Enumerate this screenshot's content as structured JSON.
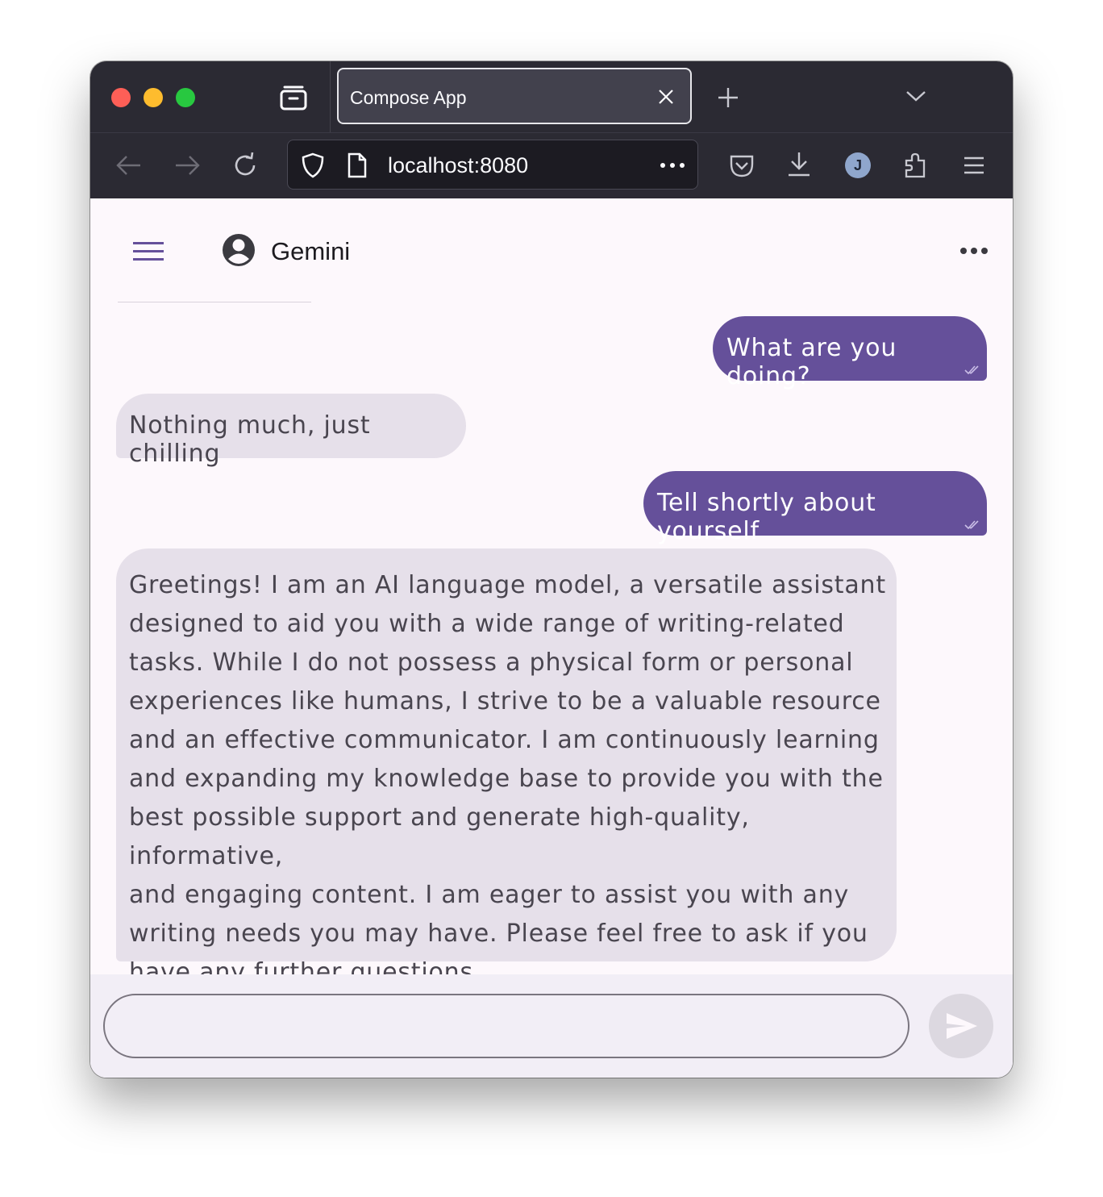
{
  "browser": {
    "tab_title": "Compose App",
    "url": "localhost:8080",
    "profile_initial": "J"
  },
  "app": {
    "title": "Gemini"
  },
  "messages": [
    {
      "role": "user",
      "text": "What are you doing?",
      "status": "read"
    },
    {
      "role": "bot",
      "text": "Nothing much, just chilling"
    },
    {
      "role": "user",
      "text": "Tell shortly about yourself",
      "status": "read"
    },
    {
      "role": "bot",
      "lines": [
        "Greetings! I am an AI language model, a versatile assistant",
        "designed to aid you with a wide range of writing-related",
        "tasks. While I do not possess a physical form or personal",
        "experiences like humans, I strive to be a valuable resource",
        "and an effective communicator. I am continuously learning",
        "and expanding my knowledge base to provide you with the",
        "best possible support and generate high-quality, informative,",
        "and engaging content. I am eager to assist you with any",
        "writing needs you may have. Please feel free to ask if you",
        "have any further questions."
      ]
    }
  ],
  "composer": {
    "value": "",
    "placeholder": ""
  },
  "colors": {
    "user_bubble": "#65509a",
    "bot_bubble": "#e6e0ea",
    "background": "#fdf8fc",
    "input_bar": "#f2eef6"
  }
}
